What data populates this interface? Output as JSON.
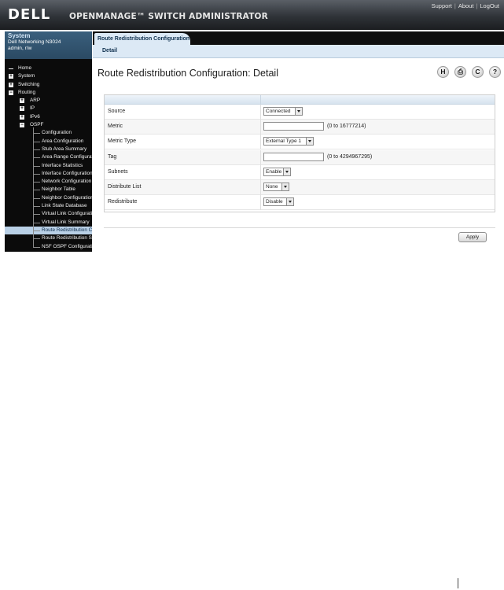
{
  "header": {
    "logo": "DELL",
    "product_title": "OPENMANAGE™ SWITCH ADMINISTRATOR",
    "links": [
      "Support",
      "About",
      "LogOut"
    ]
  },
  "system": {
    "title": "System",
    "model": "Dell Networking N3024",
    "user": "admin, r/w"
  },
  "tree": [
    {
      "label": "Home",
      "level": 0,
      "toggle": "dash"
    },
    {
      "label": "System",
      "level": 0,
      "toggle": "+"
    },
    {
      "label": "Switching",
      "level": 0,
      "toggle": "+"
    },
    {
      "label": "Routing",
      "level": 0,
      "toggle": "-"
    },
    {
      "label": "ARP",
      "level": 1,
      "toggle": "+"
    },
    {
      "label": "IP",
      "level": 1,
      "toggle": "+"
    },
    {
      "label": "IPv6",
      "level": 1,
      "toggle": "+"
    },
    {
      "label": "OSPF",
      "level": 1,
      "toggle": "-"
    },
    {
      "label": "Configuration",
      "level": 2
    },
    {
      "label": "Area Configuration",
      "level": 2
    },
    {
      "label": "Stub Area Summary",
      "level": 2
    },
    {
      "label": "Area Range Configuration",
      "level": 2
    },
    {
      "label": "Interface Statistics",
      "level": 2
    },
    {
      "label": "Interface Configuration",
      "level": 2
    },
    {
      "label": "Network Configuration",
      "level": 2
    },
    {
      "label": "Neighbor Table",
      "level": 2
    },
    {
      "label": "Neighbor Configuration",
      "level": 2
    },
    {
      "label": "Link State Database",
      "level": 2
    },
    {
      "label": "Virtual Link Configuration",
      "level": 2
    },
    {
      "label": "Virtual Link Summary",
      "level": 2
    },
    {
      "label": "Route Redistribution Configuration",
      "level": 2,
      "selected": true
    },
    {
      "label": "Route Redistribution Summary",
      "level": 2
    },
    {
      "label": "NSF OSPF Configuration",
      "level": 2
    }
  ],
  "tabs": {
    "active": "Route Redistribution Configuration",
    "sub": "Detail"
  },
  "page": {
    "title": "Route Redistribution Configuration: Detail",
    "tools": [
      {
        "icon": "save-icon",
        "glyph": "H"
      },
      {
        "icon": "print-icon",
        "glyph": "⎙"
      },
      {
        "icon": "refresh-icon",
        "glyph": "C"
      },
      {
        "icon": "help-icon",
        "glyph": "?"
      }
    ]
  },
  "form": [
    {
      "label": "Source",
      "control": "select",
      "value": "Connected"
    },
    {
      "label": "Metric",
      "control": "text",
      "value": "",
      "hint": "(0 to 16777214)"
    },
    {
      "label": "Metric Type",
      "control": "select",
      "value": "External Type 1"
    },
    {
      "label": "Tag",
      "control": "text",
      "value": "",
      "hint": "(0 to 4294967295)"
    },
    {
      "label": "Subnets",
      "control": "select",
      "value": "Enable"
    },
    {
      "label": "Distribute List",
      "control": "select",
      "value": "None"
    },
    {
      "label": "Redistribute",
      "control": "select",
      "value": "Disable"
    }
  ],
  "apply_label": "Apply"
}
